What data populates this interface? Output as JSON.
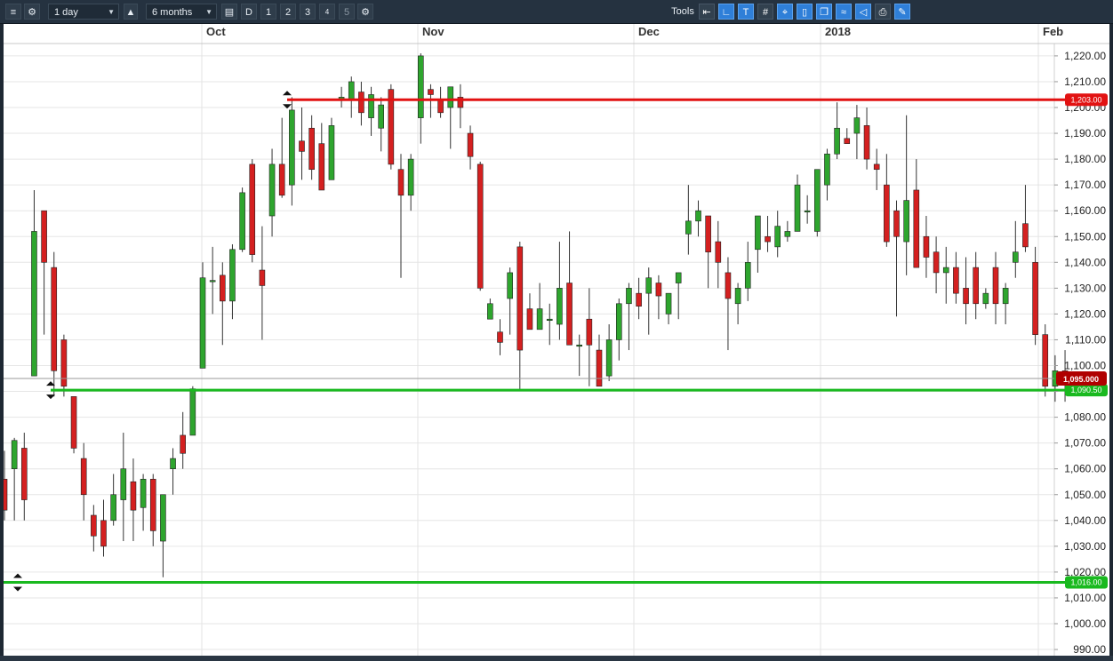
{
  "toolbar": {
    "interval_select": "1 day",
    "range_select": "6 months",
    "buttons": [
      "D",
      "1",
      "2",
      "3",
      "4",
      "5"
    ],
    "tools_label": "Tools",
    "tool_icons": [
      "undo-icon",
      "line-icon",
      "text-icon",
      "grid-icon",
      "crosshair-icon",
      "candle-icon",
      "layers-icon",
      "indicator-icon",
      "shape-icon",
      "print-icon",
      "settings-tools-icon"
    ],
    "colors": {
      "bar": "#253240",
      "highlight": "#2f7fd8"
    }
  },
  "chart_data": {
    "type": "candlestick",
    "ylim": [
      988,
      1226
    ],
    "yticks": [
      990,
      1000,
      1010,
      1020,
      1030,
      1040,
      1050,
      1060,
      1070,
      1080,
      1090,
      1100,
      1110,
      1120,
      1130,
      1140,
      1150,
      1160,
      1170,
      1180,
      1190,
      1200,
      1210,
      1220
    ],
    "ytick_labels": [
      "990.00",
      "1,000.00",
      "1,010.00",
      "1,020.00",
      "1,030.00",
      "1,040.00",
      "1,050.00",
      "1,060.00",
      "1,070.00",
      "1,080.00",
      "1,090.00",
      "1,100.00",
      "1,110.00",
      "1,120.00",
      "1,130.00",
      "1,140.00",
      "1,150.00",
      "1,160.00",
      "1,170.00",
      "1,180.00",
      "1,190.00",
      "1,200.00",
      "1,210.00",
      "1,220.00"
    ],
    "xlabels": [
      "Oct",
      "Nov",
      "Dec",
      "2018",
      "Feb"
    ],
    "colors": {
      "up": "#2ea52e",
      "down": "#d42020",
      "support": "#19b91f",
      "resistance": "#e21212",
      "price_tag": "#b00000"
    },
    "hlines": [
      {
        "value": 1203.0,
        "label": "1,203.00",
        "color": "#e21212"
      },
      {
        "value": 1090.5,
        "label": "1,090.50",
        "color": "#19b91f"
      },
      {
        "value": 1016.0,
        "label": "1,016.00",
        "color": "#19b91f"
      }
    ],
    "last_price": {
      "value": 1095.0,
      "label": "1,095.000"
    },
    "candles": [
      [
        1056,
        1067,
        1040,
        1044
      ],
      [
        1060,
        1072,
        1040,
        1071
      ],
      [
        1068,
        1074,
        1040,
        1048
      ],
      [
        1096,
        1168,
        1096,
        1152
      ],
      [
        1160,
        1160,
        1112,
        1140
      ],
      [
        1138,
        1144,
        1088,
        1098
      ],
      [
        1110,
        1112,
        1088,
        1092
      ],
      [
        1088,
        1088,
        1066,
        1068
      ],
      [
        1064,
        1070,
        1040,
        1050
      ],
      [
        1042,
        1046,
        1028,
        1034
      ],
      [
        1040,
        1048,
        1026,
        1030
      ],
      [
        1040,
        1058,
        1038,
        1050
      ],
      [
        1048,
        1074,
        1032,
        1060
      ],
      [
        1055,
        1064,
        1032,
        1044
      ],
      [
        1045,
        1058,
        1036,
        1056
      ],
      [
        1056,
        1058,
        1030,
        1036
      ],
      [
        1032,
        1050,
        1018,
        1050
      ],
      [
        1060,
        1068,
        1050,
        1064
      ],
      [
        1073,
        1082,
        1060,
        1066
      ],
      [
        1073,
        1092,
        1073,
        1091
      ],
      [
        1099,
        1140,
        1099,
        1134
      ],
      [
        1133,
        1146,
        1120,
        1133
      ],
      [
        1135,
        1140,
        1108,
        1125
      ],
      [
        1125,
        1147,
        1118,
        1145
      ],
      [
        1145,
        1169,
        1144,
        1167
      ],
      [
        1178,
        1180,
        1140,
        1143
      ],
      [
        1137,
        1154,
        1110,
        1131
      ],
      [
        1158,
        1184,
        1150,
        1178
      ],
      [
        1178,
        1196,
        1165,
        1166
      ],
      [
        1170,
        1204,
        1162,
        1199
      ],
      [
        1187,
        1200,
        1172,
        1183
      ],
      [
        1192,
        1197,
        1172,
        1176
      ],
      [
        1186,
        1194,
        1172,
        1168
      ],
      [
        1172,
        1196,
        1176,
        1193
      ],
      [
        1203,
        1208,
        1200,
        1204
      ],
      [
        1203,
        1212,
        1196,
        1210
      ],
      [
        1206,
        1210,
        1193,
        1198
      ],
      [
        1196,
        1208,
        1189,
        1205
      ],
      [
        1192,
        1204,
        1183,
        1201
      ],
      [
        1207,
        1209,
        1176,
        1178
      ],
      [
        1176,
        1182,
        1134,
        1166
      ],
      [
        1166,
        1182,
        1160,
        1180
      ],
      [
        1196,
        1221,
        1186,
        1220
      ],
      [
        1207,
        1209,
        1196,
        1205
      ],
      [
        1203,
        1208,
        1196,
        1198
      ],
      [
        1200,
        1208,
        1184,
        1208
      ],
      [
        1204,
        1209,
        1192,
        1200
      ],
      [
        1190,
        1193,
        1176,
        1181
      ],
      [
        1178,
        1179,
        1129,
        1130
      ],
      [
        1118,
        1126,
        1118,
        1124
      ],
      [
        1113,
        1118,
        1104,
        1109
      ],
      [
        1126,
        1138,
        1112,
        1136
      ],
      [
        1146,
        1148,
        1090,
        1106
      ],
      [
        1122,
        1128,
        1114,
        1114
      ],
      [
        1114,
        1132,
        1114,
        1122
      ],
      [
        1118,
        1124,
        1108,
        1118
      ],
      [
        1116,
        1148,
        1110,
        1130
      ],
      [
        1132,
        1152,
        1112,
        1108
      ],
      [
        1108,
        1112,
        1096,
        1108
      ],
      [
        1118,
        1130,
        1092,
        1108
      ],
      [
        1106,
        1112,
        1094,
        1092
      ],
      [
        1096,
        1116,
        1094,
        1110
      ],
      [
        1110,
        1126,
        1102,
        1124
      ],
      [
        1124,
        1132,
        1106,
        1130
      ],
      [
        1128,
        1134,
        1118,
        1123
      ],
      [
        1128,
        1138,
        1112,
        1134
      ],
      [
        1132,
        1135,
        1118,
        1127
      ],
      [
        1120,
        1126,
        1116,
        1128
      ],
      [
        1132,
        1134,
        1118,
        1136
      ],
      [
        1151,
        1170,
        1143,
        1156
      ],
      [
        1156,
        1164,
        1150,
        1160
      ],
      [
        1158,
        1158,
        1130,
        1144
      ],
      [
        1148,
        1156,
        1130,
        1140
      ],
      [
        1136,
        1142,
        1106,
        1126
      ],
      [
        1124,
        1132,
        1116,
        1130
      ],
      [
        1130,
        1148,
        1125,
        1140
      ],
      [
        1145,
        1157,
        1136,
        1158
      ],
      [
        1150,
        1158,
        1144,
        1148
      ],
      [
        1146,
        1160,
        1142,
        1154
      ],
      [
        1150,
        1156,
        1148,
        1152
      ],
      [
        1152,
        1174,
        1152,
        1170
      ],
      [
        1160,
        1166,
        1155,
        1160
      ],
      [
        1152,
        1172,
        1150,
        1176
      ],
      [
        1170,
        1184,
        1164,
        1182
      ],
      [
        1182,
        1202,
        1180,
        1192
      ],
      [
        1188,
        1192,
        1186,
        1186
      ],
      [
        1190,
        1201,
        1180,
        1196
      ],
      [
        1193,
        1200,
        1176,
        1180
      ],
      [
        1178,
        1184,
        1168,
        1176
      ],
      [
        1170,
        1182,
        1146,
        1148
      ],
      [
        1160,
        1164,
        1119,
        1150
      ],
      [
        1148,
        1197,
        1135,
        1164
      ],
      [
        1168,
        1180,
        1150,
        1138
      ],
      [
        1150,
        1158,
        1134,
        1142
      ],
      [
        1144,
        1150,
        1128,
        1136
      ],
      [
        1136,
        1146,
        1124,
        1138
      ],
      [
        1138,
        1144,
        1124,
        1128
      ],
      [
        1130,
        1142,
        1116,
        1124
      ],
      [
        1138,
        1144,
        1118,
        1124
      ],
      [
        1124,
        1130,
        1122,
        1128
      ],
      [
        1138,
        1144,
        1116,
        1124
      ],
      [
        1124,
        1132,
        1116,
        1130
      ],
      [
        1140,
        1156,
        1134,
        1144
      ],
      [
        1155,
        1170,
        1144,
        1146
      ],
      [
        1140,
        1146,
        1108,
        1112
      ],
      [
        1112,
        1116,
        1088,
        1092
      ],
      [
        1092,
        1104,
        1086,
        1098
      ],
      [
        1098,
        1106,
        1086,
        1095
      ]
    ]
  }
}
